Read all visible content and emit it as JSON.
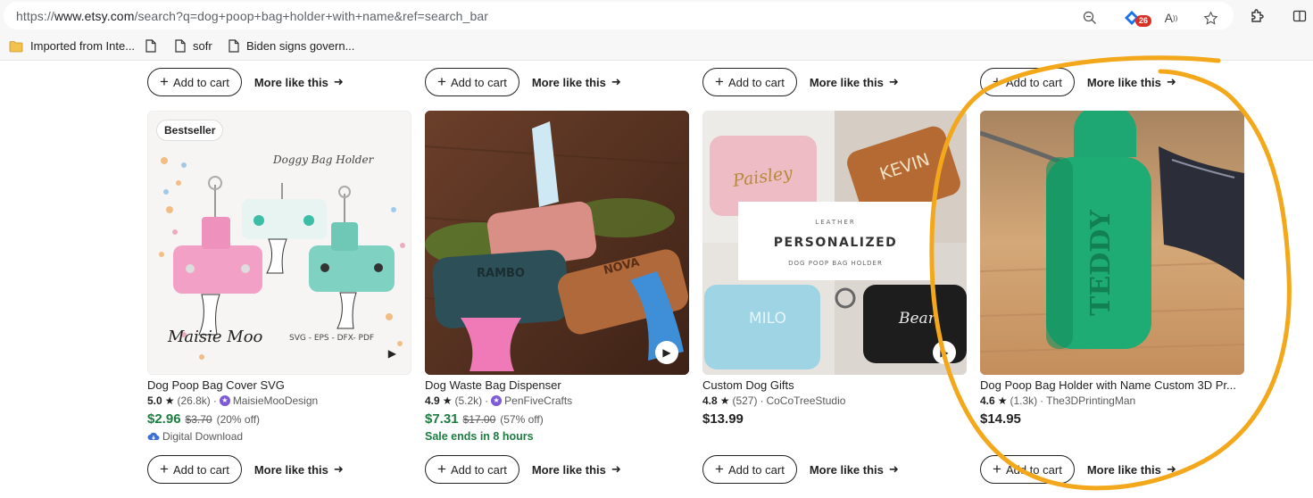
{
  "browser": {
    "url_scheme": "https://",
    "url_host": "www.etsy.com",
    "url_rest": "/search?q=dog+poop+bag+holder+with+name&ref=search_bar",
    "extension_badge": "26",
    "bookmarks": [
      {
        "label": "Imported from Inte...",
        "icon": "folder-icon"
      },
      {
        "label": "",
        "icon": "page-icon"
      },
      {
        "label": "sofr",
        "icon": "page-icon"
      },
      {
        "label": "Biden signs govern...",
        "icon": "page-icon"
      }
    ]
  },
  "actions": {
    "add_label": "Add to cart",
    "more_label": "More like this"
  },
  "products": [
    {
      "title": "Dog Poop Bag Cover SVG",
      "rating": "5.0",
      "reviews": "(26.8k)",
      "seller": "MaisieMooDesign",
      "star_seller": true,
      "price": "$2.96",
      "price_on_sale": true,
      "original_price": "$3.70",
      "discount": "(20% off)",
      "note": "Digital Download",
      "badge": "Bestseller",
      "image_text": {
        "top": "Doggy Bag Holder",
        "bottom_left": "Maisie Moo",
        "bottom_right": "SVG - EPS - DFX- PDF"
      }
    },
    {
      "title": "Dog Waste Bag Dispenser",
      "rating": "4.9",
      "reviews": "(5.2k)",
      "seller": "PenFiveCrafts",
      "star_seller": true,
      "price": "$7.31",
      "price_on_sale": true,
      "original_price": "$17.00",
      "discount": "(57% off)",
      "sale_note": "Sale ends in 8 hours",
      "image_text": {
        "left": "RAMBO",
        "right": "NOVA"
      }
    },
    {
      "title": "Custom Dog Gifts",
      "rating": "4.8",
      "reviews": "(527)",
      "seller": "CoCoTreeStudio",
      "star_seller": false,
      "price": "$13.99",
      "price_on_sale": false,
      "image_text": {
        "script1": "Paisley",
        "name2": "KEVIN",
        "overline": "LEATHER",
        "headline": "PERSONALIZED",
        "subline": "DOG POOP BAG HOLDER",
        "name3": "MILO",
        "script4": "Bear"
      }
    },
    {
      "title": "Dog Poop Bag Holder with Name Custom 3D Pr...",
      "rating": "4.6",
      "reviews": "(1.3k)",
      "seller": "The3DPrintingMan",
      "star_seller": false,
      "price": "$14.95",
      "price_on_sale": false,
      "image_text": {
        "engraving": "TEDDY"
      }
    }
  ],
  "colors": {
    "sale_green": "#1b7d3f",
    "annotation_orange": "#f3a81c",
    "star_seller_purple": "#7e5bd6"
  }
}
